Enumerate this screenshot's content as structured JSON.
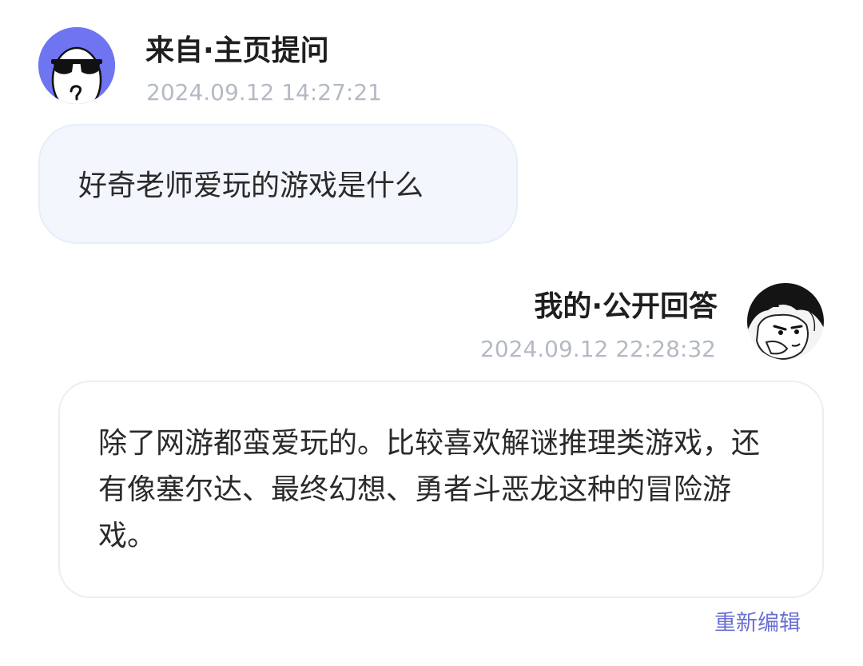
{
  "question": {
    "source_label": "来自·主页提问",
    "timestamp": "2024.09.12 14:27:21",
    "text": "好奇老师爱玩的游戏是什么"
  },
  "answer": {
    "source_label": "我的·公开回答",
    "timestamp": "2024.09.12 22:28:32",
    "text": "除了网游都蛮爱玩的。比较喜欢解谜推理类游戏，还有像塞尔达、最终幻想、勇者斗恶龙这种的冒险游戏。"
  },
  "actions": {
    "edit_label": "重新编辑"
  },
  "colors": {
    "question_avatar_bg": "#6f74f0",
    "question_bubble_bg": "#f3f7fd",
    "timestamp": "#b4bac4",
    "link": "#6a70d4"
  },
  "icons": {
    "question_avatar": "anonymous-sunglasses-avatar-icon",
    "answer_avatar": "manga-character-avatar-icon"
  }
}
